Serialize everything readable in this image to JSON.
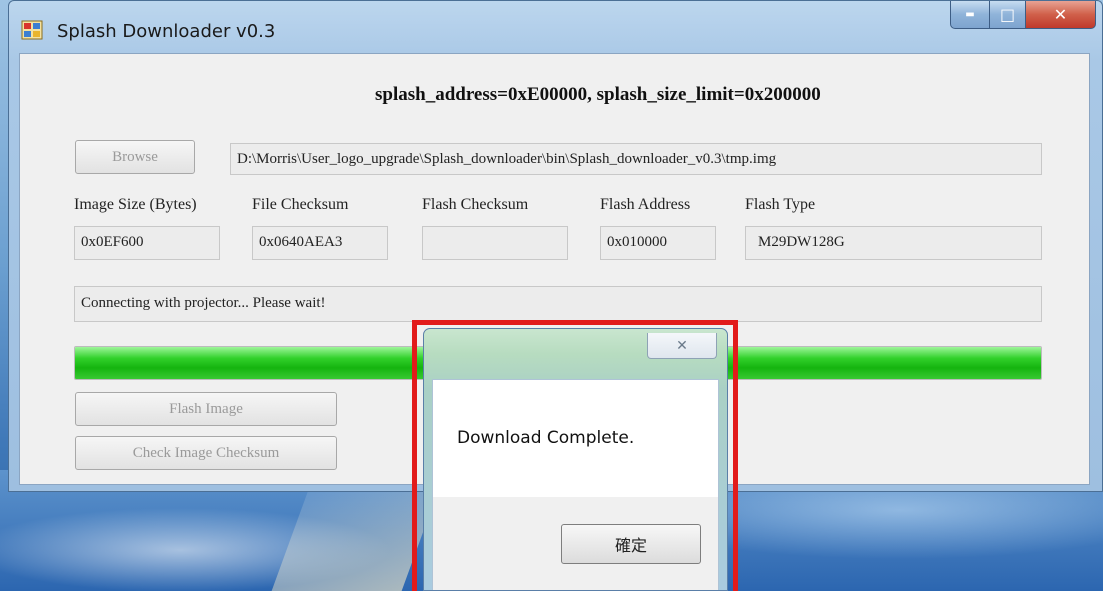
{
  "window": {
    "title": "Splash Downloader  v0.3",
    "min_glyph": "▬",
    "max_glyph": "□",
    "close_glyph": "✕"
  },
  "header": {
    "info": "splash_address=0xE00000, splash_size_limit=0x200000"
  },
  "browse": {
    "label": "Browse",
    "path": "D:\\Morris\\User_logo_upgrade\\Splash_downloader\\bin\\Splash_downloader_v0.3\\tmp.img"
  },
  "fields": [
    {
      "label": "Image Size (Bytes)",
      "value": "0x0EF600"
    },
    {
      "label": "File Checksum",
      "value": "0x0640AEA3"
    },
    {
      "label": "Flash Checksum",
      "value": ""
    },
    {
      "label": "Flash Address",
      "value": "0x010000"
    },
    {
      "label": "Flash Type",
      "value": "M29DW128G"
    }
  ],
  "status": "Connecting with projector... Please wait!",
  "progress": {
    "percent": 100,
    "color": "#1fbf18"
  },
  "buttons": {
    "flash_image": "Flash Image",
    "check_checksum": "Check Image Checksum"
  },
  "dialog": {
    "message": "Download Complete.",
    "ok_label": "確定",
    "close_glyph": "✕"
  },
  "highlight_color": "#e21b1b"
}
